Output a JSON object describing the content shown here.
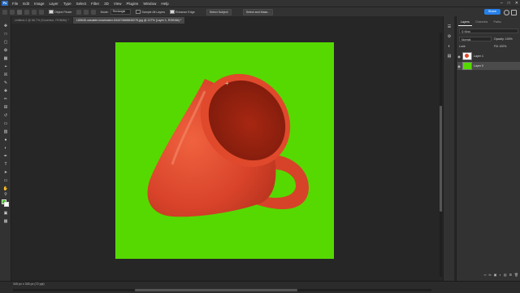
{
  "app": {
    "logo": "Ps"
  },
  "menu": [
    "File",
    "Edit",
    "Image",
    "Layer",
    "Type",
    "Select",
    "Filter",
    "3D",
    "View",
    "Plugins",
    "Window",
    "Help"
  ],
  "options_bar": {
    "object_finder_label": "Object Finder",
    "mode_label": "Mode:",
    "mode_value": "Rectangle",
    "sample_all_layers_label": "Sample All Layers",
    "enhance_edge_label": "Enhance Edge",
    "select_subject_label": "Select Subject",
    "select_and_mask_label": "Select and Mask...",
    "share_label": "Share"
  },
  "tabs": [
    {
      "label": "Untitled-2 @ 66.7% (Sunshine, RGB/8#) *",
      "active": false
    },
    {
      "label": "185645-valuable-bowlmaker-544474668845275.jpg @ 127% (Layer 1, RGB/8#) *",
      "active": true
    }
  ],
  "layers_panel": {
    "tabs": [
      "Layers",
      "Channels",
      "Paths"
    ],
    "filter_label": "Kind",
    "blend_mode": "Normal",
    "opacity_label": "Opacity:",
    "opacity_value": "100%",
    "lock_label": "Lock:",
    "fill_label": "Fill:",
    "fill_value": "100%",
    "layers": [
      {
        "name": "Layer 1",
        "selected": false
      },
      {
        "name": "Layer 0",
        "selected": true
      }
    ]
  },
  "colors": {
    "foreground": "#3bc41a",
    "background": "#ffffff",
    "canvas_fill": "#56d900",
    "mug": "#e2472a",
    "accent": "#2680eb"
  },
  "status": {
    "text": "345 px x 345 px (72 ppi)"
  }
}
